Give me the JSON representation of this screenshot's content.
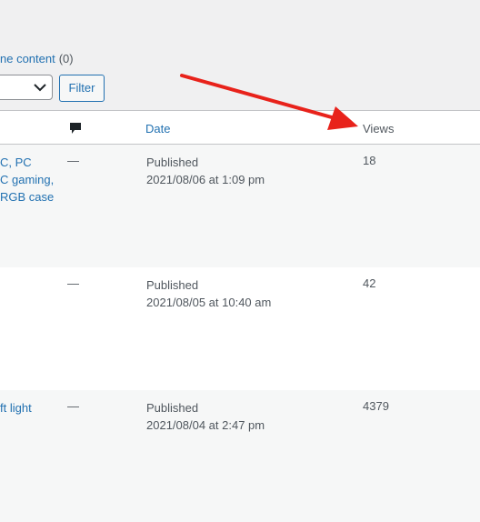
{
  "subsubsub": {
    "link_text": "ne content",
    "count": "(0)"
  },
  "filter": {
    "select_value": "",
    "button_label": "Filter"
  },
  "table": {
    "headers": {
      "comments_icon": "comment-bubble-icon",
      "date": "Date",
      "views": "Views"
    },
    "rows": [
      {
        "title_lines": [
          "C, PC",
          "C gaming,",
          "RGB case"
        ],
        "comments": "—",
        "status": "Published",
        "date": "2021/08/06 at 1:09 pm",
        "views": "18"
      },
      {
        "title_lines": [],
        "comments": "—",
        "status": "Published",
        "date": "2021/08/05 at 10:40 am",
        "views": "42"
      },
      {
        "title_lines": [
          "ft light"
        ],
        "comments": "—",
        "status": "Published",
        "date": "2021/08/04 at 2:47 pm",
        "views": "4379"
      }
    ]
  },
  "colors": {
    "link": "#2271b1",
    "text": "#50575e",
    "arrow": "#e8221b",
    "alt_row": "#f6f7f7"
  }
}
